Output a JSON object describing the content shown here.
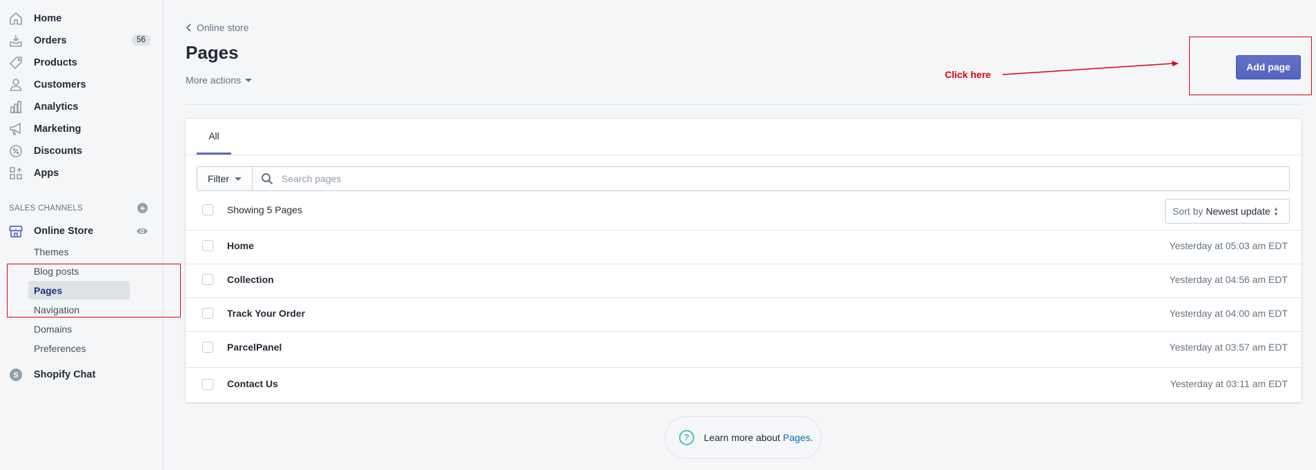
{
  "sidebar": {
    "items": [
      {
        "label": "Home",
        "icon": "home-icon"
      },
      {
        "label": "Orders",
        "icon": "orders-icon",
        "badge": "56"
      },
      {
        "label": "Products",
        "icon": "tag-icon"
      },
      {
        "label": "Customers",
        "icon": "person-icon"
      },
      {
        "label": "Analytics",
        "icon": "bar-chart-icon"
      },
      {
        "label": "Marketing",
        "icon": "megaphone-icon"
      },
      {
        "label": "Discounts",
        "icon": "discount-icon"
      },
      {
        "label": "Apps",
        "icon": "apps-icon"
      }
    ],
    "sales_channels_heading": "SALES CHANNELS",
    "online_store": {
      "label": "Online Store",
      "icon": "store-icon"
    },
    "sub_items": [
      "Themes",
      "Blog posts",
      "Pages",
      "Navigation",
      "Domains",
      "Preferences"
    ],
    "active_sub_item": "Pages",
    "shopify_chat": {
      "label": "Shopify Chat",
      "icon": "shopify-chat-icon"
    }
  },
  "header": {
    "breadcrumb": "Online store",
    "title": "Pages",
    "more_actions": "More actions",
    "add_button": "Add page"
  },
  "annotation": {
    "text": "Click here",
    "color": "#e0000f"
  },
  "card": {
    "tabs": [
      "All"
    ],
    "filter_label": "Filter",
    "search_placeholder": "Search pages",
    "showing_text": "Showing 5 Pages",
    "sort_label": "Sort by",
    "sort_value": "Newest update",
    "rows": [
      {
        "title": "Home",
        "date": "Yesterday at 05:03 am EDT"
      },
      {
        "title": "Collection",
        "date": "Yesterday at 04:56 am EDT"
      },
      {
        "title": "Track Your Order",
        "date": "Yesterday at 04:00 am EDT"
      },
      {
        "title": "ParcelPanel",
        "date": "Yesterday at 03:57 am EDT"
      },
      {
        "title": "Contact Us",
        "date": "Yesterday at 03:11 am EDT"
      }
    ]
  },
  "learn_more": {
    "prefix": "Learn more about",
    "link": "Pages",
    "suffix": "."
  },
  "colors": {
    "accent": "#5c6ac4",
    "link": "#006fbb",
    "annotation_red": "#e0000f"
  }
}
